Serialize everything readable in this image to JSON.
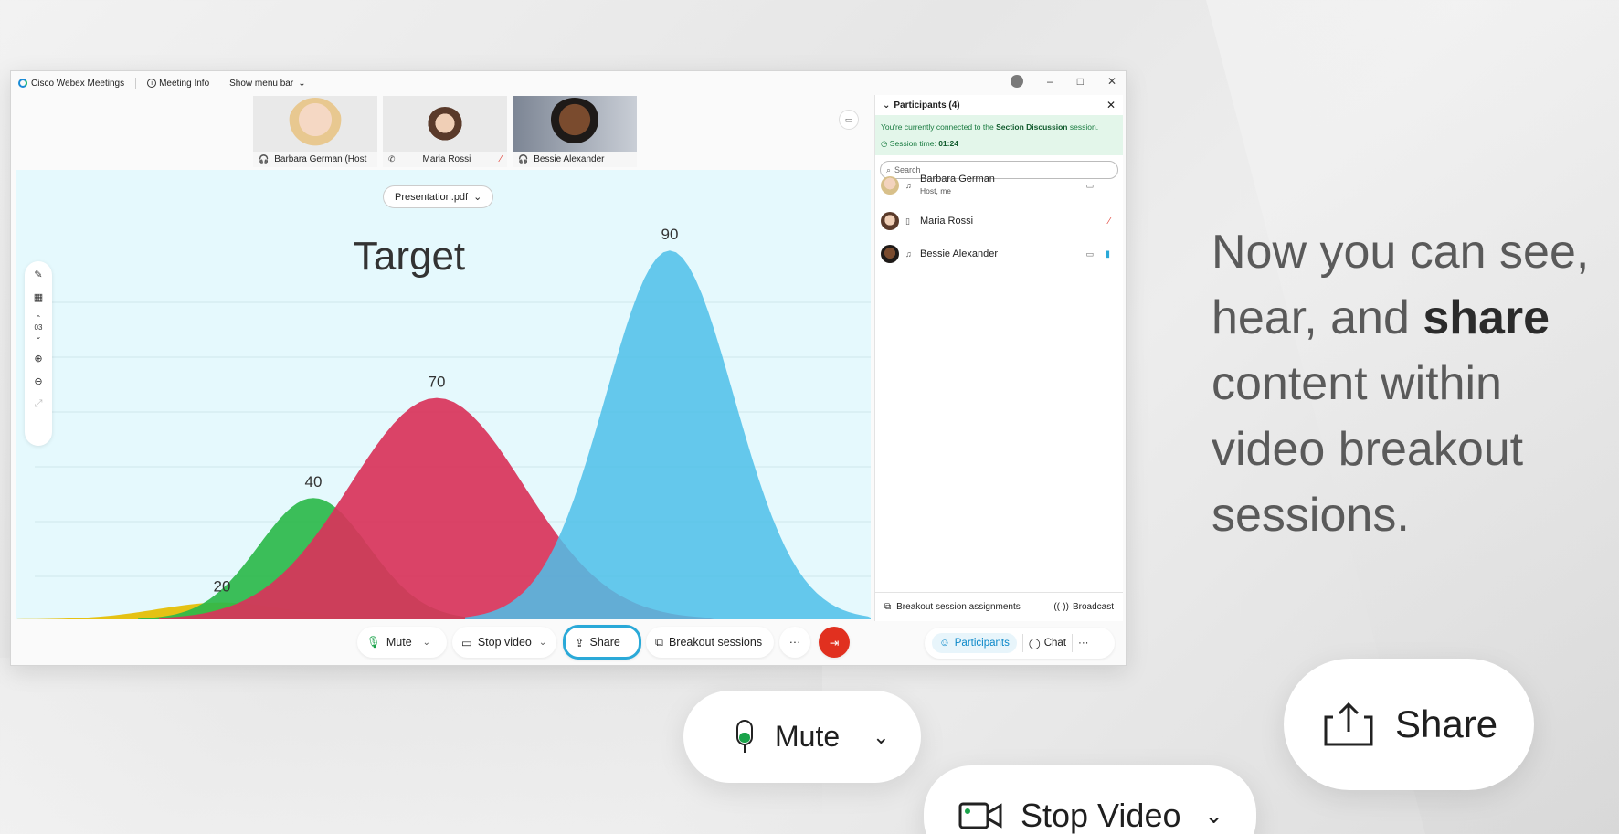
{
  "titlebar": {
    "app_name": "Cisco Webex Meetings",
    "meeting_info": "Meeting Info",
    "menu_toggle": "Show menu bar",
    "minimize": "–",
    "maximize": "□",
    "close": "✕"
  },
  "thumbnails": [
    {
      "name": "Barbara German (Host",
      "audio": "headset"
    },
    {
      "name": "Maria Rossi",
      "audio": "phone"
    },
    {
      "name": "Bessie Alexander",
      "audio": "headset"
    }
  ],
  "stage": {
    "file": "Presentation.pdf",
    "page": "03"
  },
  "chart_data": {
    "type": "area",
    "title": "Target",
    "series": [
      {
        "name": "",
        "peak": 20,
        "color": "#e5bd00"
      },
      {
        "name": "",
        "peak": 40,
        "color": "#2db84b"
      },
      {
        "name": "",
        "peak": 70,
        "color": "#d9335a"
      },
      {
        "name": "",
        "peak": 90,
        "color": "#4dbfe9"
      }
    ],
    "data_labels": [
      "20",
      "40",
      "70",
      "90"
    ]
  },
  "panel": {
    "title": "Participants (4)",
    "notice_prefix": "You're currently connected to the",
    "notice_session": "Section Discussion",
    "notice_suffix": "session.",
    "session_time_label": "Session time:",
    "session_time": "01:24",
    "search_placeholder": "Search",
    "participants": [
      {
        "name": "Barbara German",
        "sub": "Host, me"
      },
      {
        "name": "Maria Rossi",
        "sub": ""
      },
      {
        "name": "Bessie Alexander",
        "sub": ""
      }
    ],
    "footer_assign": "Breakout session assignments",
    "footer_broadcast": "Broadcast"
  },
  "controls": {
    "mute": "Mute",
    "stop_video": "Stop video",
    "share": "Share",
    "breakout": "Breakout sessions",
    "more": "···",
    "participants": "Participants",
    "chat": "Chat"
  },
  "tagline": {
    "line1": "Now you can see,",
    "line2_a": "hear, and",
    "line2_b": "share",
    "line3": "content within",
    "line4": "video breakout",
    "line5": "sessions."
  },
  "big_buttons": {
    "mute": "Mute",
    "share": "Share",
    "stop_video": "Stop Video"
  },
  "colors": {
    "accent": "#0a87c8",
    "end_call": "#e1301f",
    "share_highlight": "#2aa9d8",
    "stage_bg": "#e5f9fd"
  }
}
